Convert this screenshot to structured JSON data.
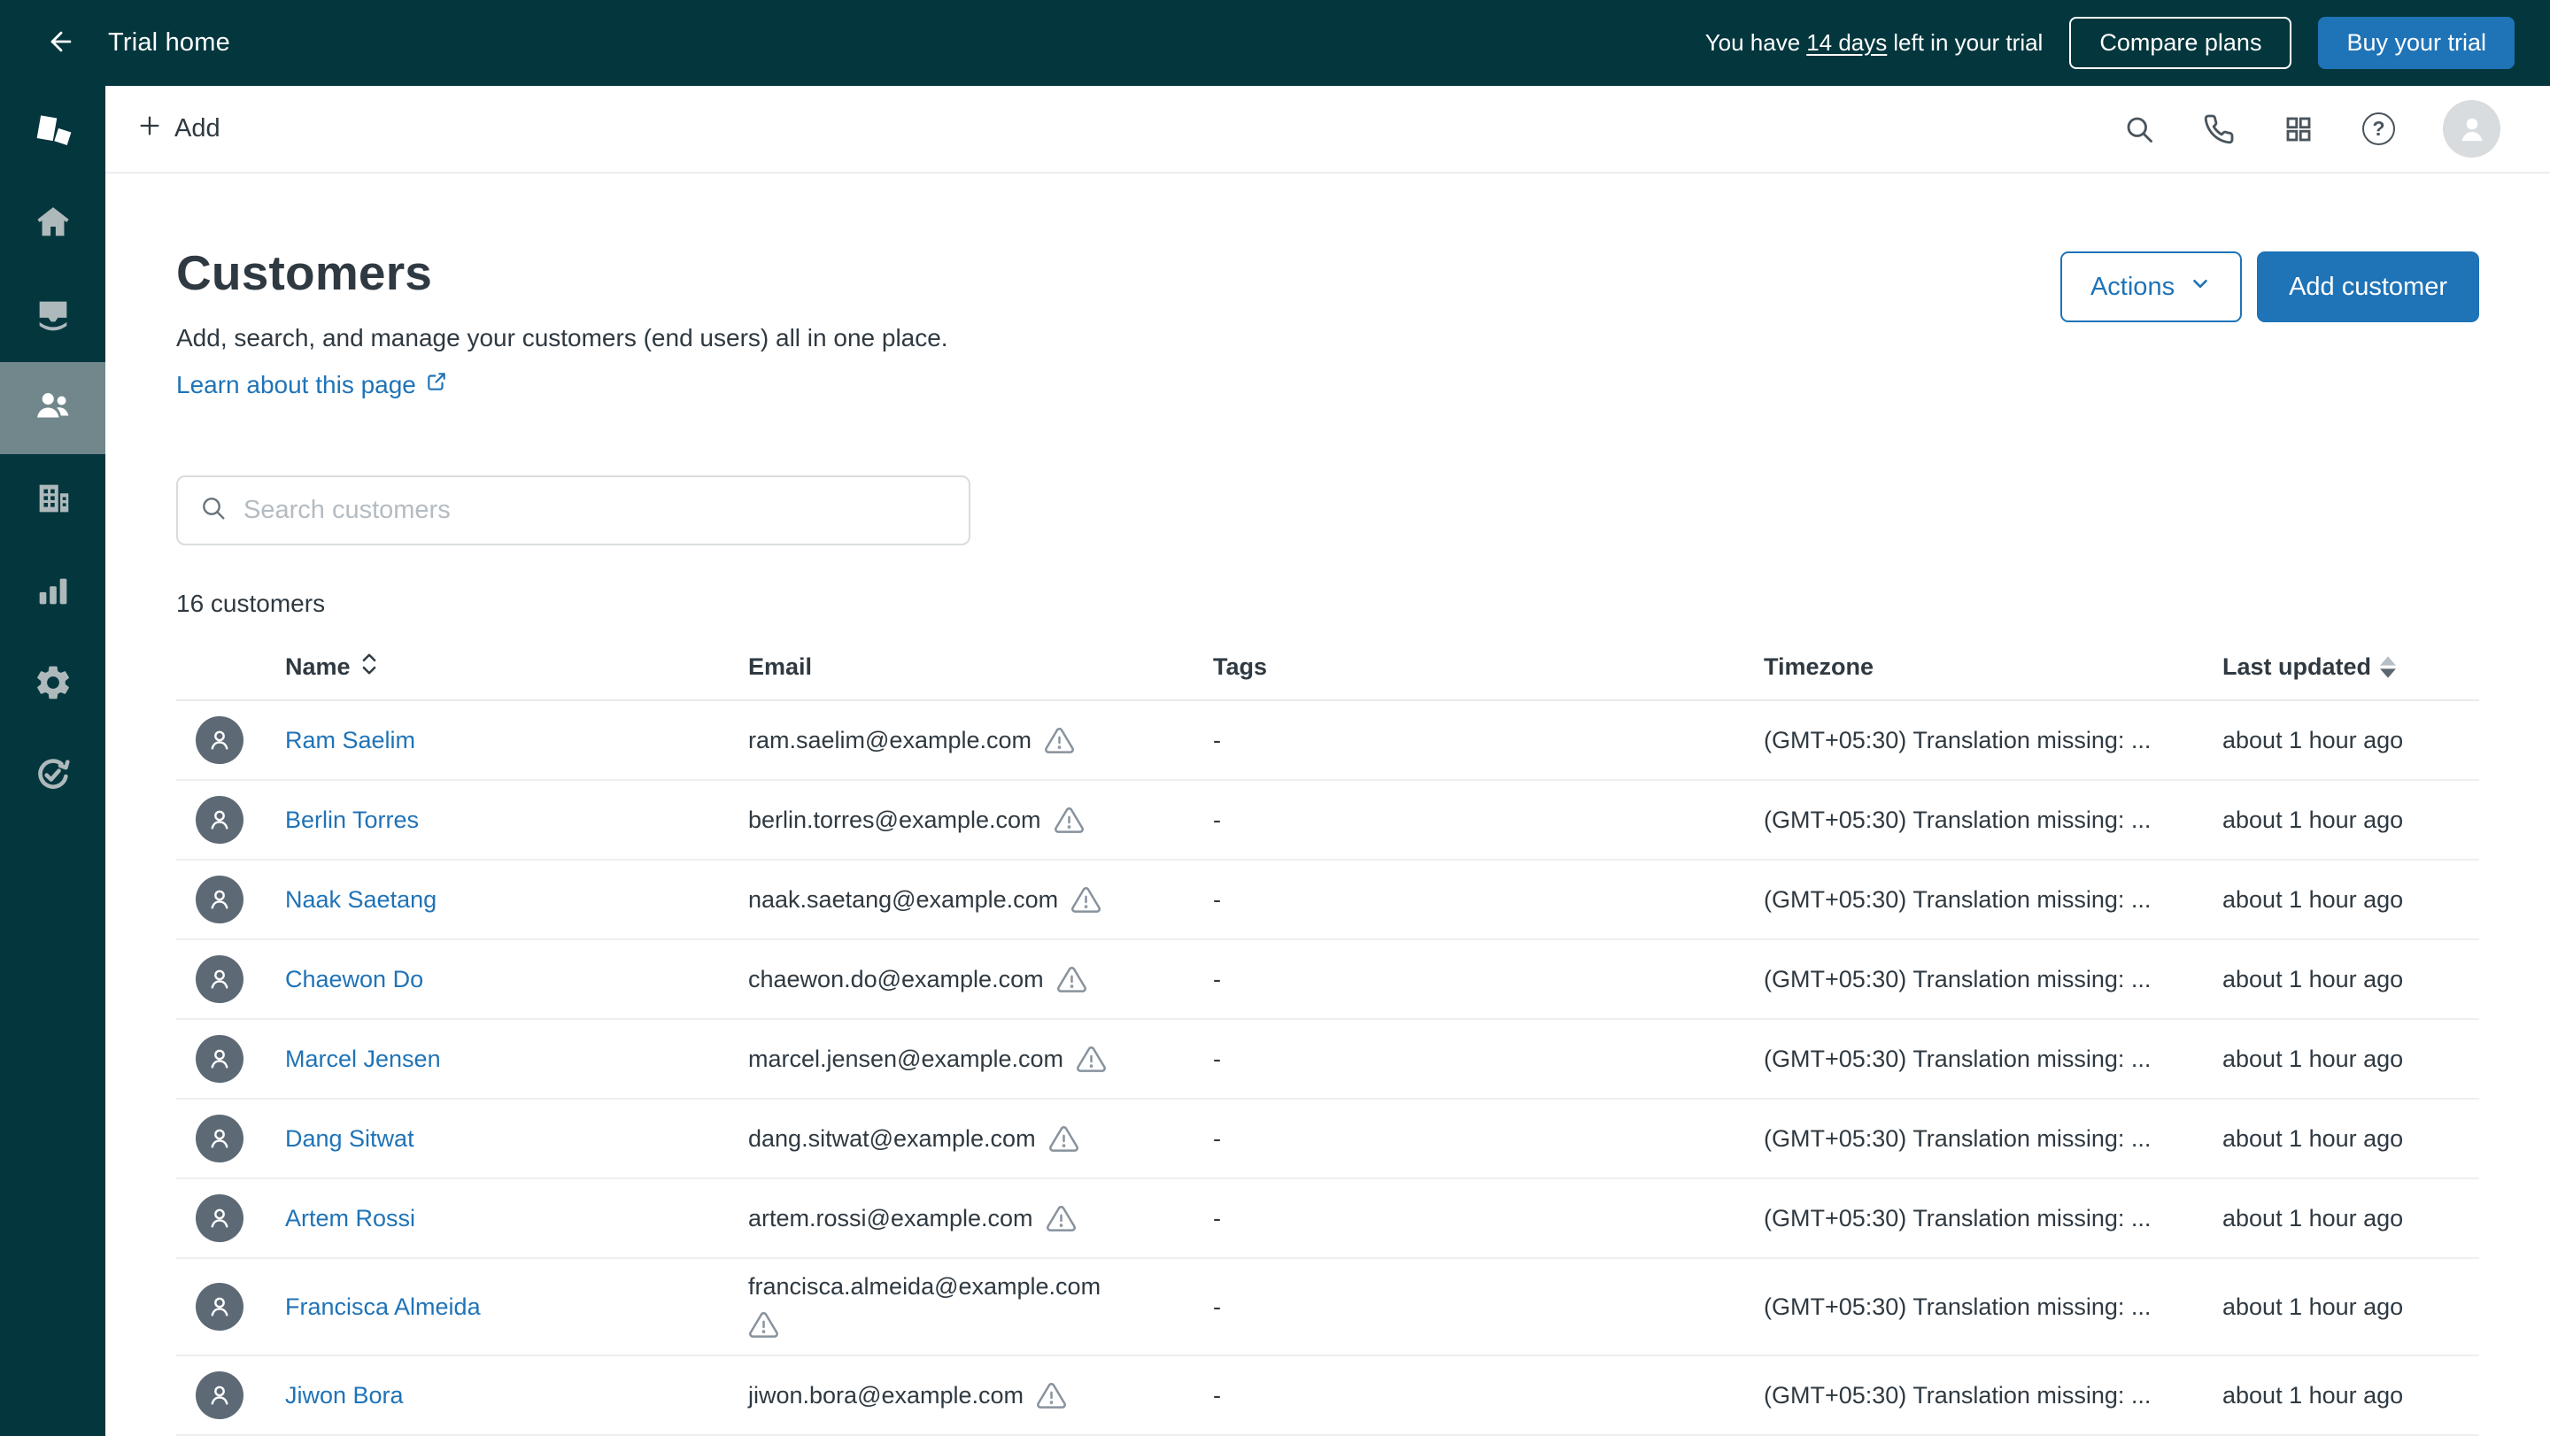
{
  "topbar": {
    "back_label": "Trial home",
    "trial_prefix": "You have",
    "trial_days": "14 days",
    "trial_suffix": "left in your trial",
    "compare_plans": "Compare plans",
    "buy_trial": "Buy your trial"
  },
  "appbar": {
    "add_label": "Add",
    "help_glyph": "?",
    "icon_names": [
      "search-icon",
      "phone-icon",
      "apps-grid-icon",
      "help-icon",
      "user-avatar"
    ]
  },
  "sidebar": {
    "icon_names": [
      "zendesk-logo",
      "home-icon",
      "tickets-icon",
      "customers-icon",
      "organizations-icon",
      "reporting-icon",
      "settings-icon",
      "trial-progress-icon"
    ],
    "selected": "customers-icon"
  },
  "page": {
    "title": "Customers",
    "subtitle": "Add, search, and manage your customers (end users) all in one place.",
    "learn_link": "Learn about this page",
    "actions": "Actions",
    "add_customer": "Add customer",
    "search_placeholder": "Search customers",
    "count": "16 customers"
  },
  "table": {
    "headers": {
      "name": "Name",
      "email": "Email",
      "tags": "Tags",
      "timezone": "Timezone",
      "last_updated": "Last updated"
    },
    "rows": [
      {
        "name": "Ram Saelim",
        "email": "ram.saelim@example.com",
        "tags": "-",
        "timezone": "(GMT+05:30) Translation missing: ...",
        "last_updated": "about 1 hour ago"
      },
      {
        "name": "Berlin Torres",
        "email": "berlin.torres@example.com",
        "tags": "-",
        "timezone": "(GMT+05:30) Translation missing: ...",
        "last_updated": "about 1 hour ago"
      },
      {
        "name": "Naak Saetang",
        "email": "naak.saetang@example.com",
        "tags": "-",
        "timezone": "(GMT+05:30) Translation missing: ...",
        "last_updated": "about 1 hour ago"
      },
      {
        "name": "Chaewon Do",
        "email": "chaewon.do@example.com",
        "tags": "-",
        "timezone": "(GMT+05:30) Translation missing: ...",
        "last_updated": "about 1 hour ago"
      },
      {
        "name": "Marcel Jensen",
        "email": "marcel.jensen@example.com",
        "tags": "-",
        "timezone": "(GMT+05:30) Translation missing: ...",
        "last_updated": "about 1 hour ago"
      },
      {
        "name": "Dang Sitwat",
        "email": "dang.sitwat@example.com",
        "tags": "-",
        "timezone": "(GMT+05:30) Translation missing: ...",
        "last_updated": "about 1 hour ago"
      },
      {
        "name": "Artem Rossi",
        "email": "artem.rossi@example.com",
        "tags": "-",
        "timezone": "(GMT+05:30) Translation missing: ...",
        "last_updated": "about 1 hour ago"
      },
      {
        "name": "Francisca Almeida",
        "email": "francisca.almeida@example.com",
        "tags": "-",
        "timezone": "(GMT+05:30) Translation missing: ...",
        "last_updated": "about 1 hour ago"
      },
      {
        "name": "Jiwon Bora",
        "email": "jiwon.bora@example.com",
        "tags": "-",
        "timezone": "(GMT+05:30) Translation missing: ...",
        "last_updated": "about 1 hour ago"
      }
    ]
  },
  "colors": {
    "topbar_bg": "#03363D",
    "sidebar_selected_bg": "#71878B",
    "accent_blue": "#1F73B7",
    "text_dark": "#2F3941",
    "muted_gray": "#68737D",
    "row_border": "#E9EBED",
    "avatar_bg": "#5D6974"
  }
}
